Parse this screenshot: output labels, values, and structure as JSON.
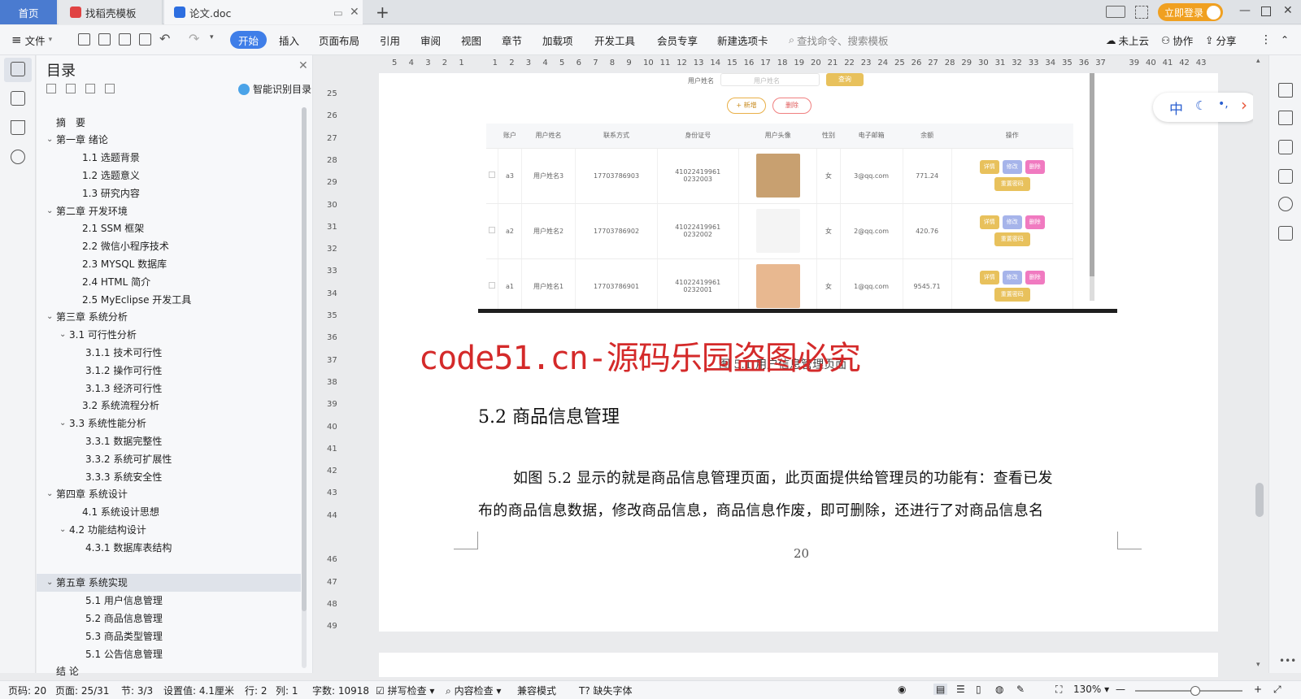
{
  "tabs": {
    "home": "首页",
    "t2": "找稻壳模板",
    "t3": "论文.doc",
    "login": "立即登录"
  },
  "toolbar": {
    "file": "文件",
    "items": [
      "开始",
      "插入",
      "页面布局",
      "引用",
      "审阅",
      "视图",
      "章节",
      "加载项",
      "开发工具",
      "会员专享",
      "新建选项卡"
    ],
    "search": "查找命令、搜索模板",
    "cloud": "未上云",
    "collab": "协作",
    "share": "分享"
  },
  "ruler_h": [
    "5",
    "4",
    "3",
    "2",
    "1",
    "",
    "1",
    "2",
    "3",
    "4",
    "5",
    "6",
    "7",
    "8",
    "9",
    "10",
    "11",
    "12",
    "13",
    "14",
    "15",
    "16",
    "17",
    "18",
    "19",
    "20",
    "21",
    "22",
    "23",
    "24",
    "25",
    "26",
    "27",
    "28",
    "29",
    "30",
    "31",
    "32",
    "33",
    "34",
    "35",
    "36",
    "37",
    "",
    "39",
    "40",
    "41",
    "42",
    "43"
  ],
  "ruler_v": [
    "25",
    "26",
    "27",
    "28",
    "29",
    "30",
    "31",
    "32",
    "33",
    "34",
    "35",
    "36",
    "37",
    "38",
    "39",
    "40",
    "41",
    "42",
    "43",
    "44",
    "",
    "46",
    "47",
    "48",
    "49"
  ],
  "toc": {
    "title": "目录",
    "smart": "智能识别目录",
    "items": [
      {
        "t": "摘　要",
        "lv": 0,
        "chev": ""
      },
      {
        "t": "第一章  绪论",
        "lv": 0,
        "chev": "v"
      },
      {
        "t": "1.1  选题背景",
        "lv": 1,
        "chev": ""
      },
      {
        "t": "1.2  选题意义",
        "lv": 1,
        "chev": ""
      },
      {
        "t": "1.3  研究内容",
        "lv": 1,
        "chev": ""
      },
      {
        "t": "第二章  开发环境",
        "lv": 0,
        "chev": "v"
      },
      {
        "t": "2.1 SSM 框架",
        "lv": 1,
        "chev": ""
      },
      {
        "t": "2.2 微信小程序技术",
        "lv": 1,
        "chev": ""
      },
      {
        "t": "2.3 MYSQL 数据库",
        "lv": 1,
        "chev": ""
      },
      {
        "t": "2.4 HTML 简介",
        "lv": 1,
        "chev": ""
      },
      {
        "t": "2.5 MyEclipse 开发工具",
        "lv": 1,
        "chev": ""
      },
      {
        "t": "第三章  系统分析",
        "lv": 0,
        "chev": "v"
      },
      {
        "t": "3.1 可行性分析",
        "lv": 1,
        "chev": "v"
      },
      {
        "t": "3.1.1 技术可行性",
        "lv": 2,
        "chev": ""
      },
      {
        "t": "3.1.2 操作可行性",
        "lv": 2,
        "chev": ""
      },
      {
        "t": "3.1.3 经济可行性",
        "lv": 2,
        "chev": ""
      },
      {
        "t": "3.2 系统流程分析",
        "lv": 1,
        "chev": ""
      },
      {
        "t": "3.3 系统性能分析",
        "lv": 1,
        "chev": "v"
      },
      {
        "t": "3.3.1 数据完整性",
        "lv": 2,
        "chev": ""
      },
      {
        "t": "3.3.2 系统可扩展性",
        "lv": 2,
        "chev": ""
      },
      {
        "t": "3.3.3 系统安全性",
        "lv": 2,
        "chev": ""
      },
      {
        "t": "第四章  系统设计",
        "lv": 0,
        "chev": "v"
      },
      {
        "t": "4.1  系统设计思想",
        "lv": 1,
        "chev": ""
      },
      {
        "t": "4.2 功能结构设计",
        "lv": 1,
        "chev": "v"
      },
      {
        "t": "4.3.1  数据库表结构",
        "lv": 2,
        "chev": ""
      },
      {
        "t": "",
        "lv": 0,
        "chev": ""
      },
      {
        "t": "第五章  系统实现",
        "lv": 0,
        "chev": "v"
      },
      {
        "t": "5.1 用户信息管理",
        "lv": 2,
        "chev": ""
      },
      {
        "t": "5.2  商品信息管理",
        "lv": 2,
        "chev": ""
      },
      {
        "t": "5.3 商品类型管理",
        "lv": 2,
        "chev": ""
      },
      {
        "t": "5.1 公告信息管理",
        "lv": 2,
        "chev": ""
      },
      {
        "t": "结  论",
        "lv": 0,
        "chev": ""
      }
    ]
  },
  "shot": {
    "search_label": "用户姓名",
    "search_ph": "用户姓名",
    "query": "查询",
    "add": "+ 新增",
    "del": "删除",
    "headers": [
      "",
      "账户",
      "用户姓名",
      "联系方式",
      "身份证号",
      "用户头像",
      "性别",
      "电子邮箱",
      "余额",
      "操作"
    ],
    "rows": [
      {
        "acc": "a3",
        "name": "用户姓名3",
        "phone": "17703786903",
        "id1": "41022419961",
        "id2": "0232003",
        "sex": "女",
        "mail": "3@qq.com",
        "bal": "771.24"
      },
      {
        "acc": "a2",
        "name": "用户姓名2",
        "phone": "17703786902",
        "id1": "41022419961",
        "id2": "0232002",
        "sex": "女",
        "mail": "2@qq.com",
        "bal": "420.76"
      },
      {
        "acc": "a1",
        "name": "用户姓名1",
        "phone": "17703786901",
        "id1": "41022419961",
        "id2": "0232001",
        "sex": "女",
        "mail": "1@qq.com",
        "bal": "9545.71"
      }
    ],
    "btn_detail": "详情",
    "btn_edit": "修改",
    "btn_del": "删除",
    "btn_reset": "重置密码"
  },
  "doc": {
    "watermark": "code51.cn-源码乐园盗图必究",
    "caption": "图 5.1 用户信息管理页面",
    "heading": "5.2  商品信息管理",
    "para1": "如图 5.2 显示的就是商品信息管理页面，此页面提供给管理员的功能有：查看已发",
    "para2": "布的商品信息数据，修改商品信息，商品信息作废，即可删除，还进行了对商品信息名",
    "page_num": "20"
  },
  "float": {
    "zh": "中"
  },
  "status": {
    "page": "页码: 20",
    "pages": "页面: 25/31",
    "sec": "节: 3/3",
    "setting": "设置值: 4.1厘米",
    "row": "行: 2",
    "col": "列: 1",
    "words": "字数: 10918",
    "spell": "拼写检查",
    "content": "内容检查",
    "compat": "兼容模式",
    "missing": "缺失字体",
    "zoom": "130%"
  }
}
